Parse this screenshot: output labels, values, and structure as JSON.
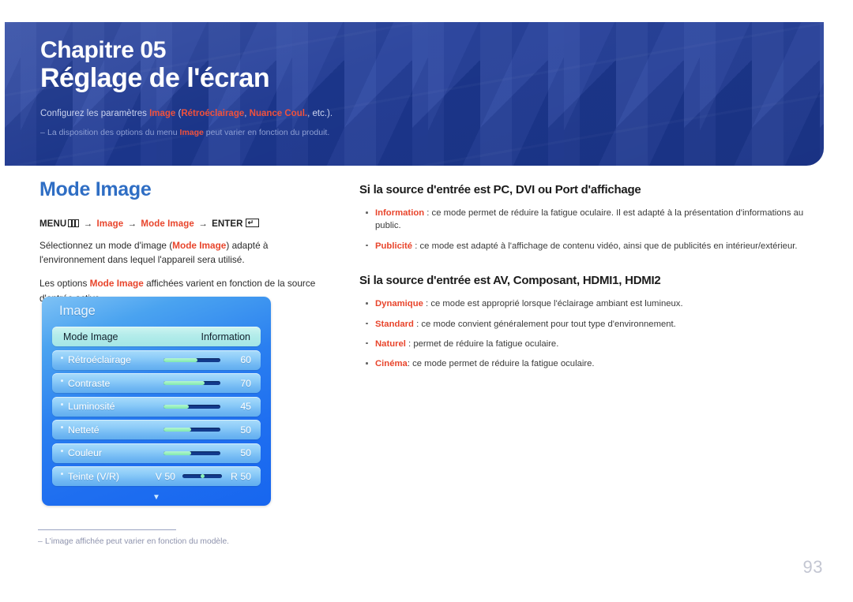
{
  "banner": {
    "chapter_label": "Chapitre 05",
    "chapter_title": "Réglage de l'écran",
    "description_pre": "Configurez les paramètres ",
    "description_hi1": "Image",
    "description_mid": " (",
    "description_hi2": "Rétroéclairage",
    "description_mid2": ", ",
    "description_hi3": "Nuance Coul.",
    "description_post": ", etc.).",
    "note_pre": "La disposition des options du menu ",
    "note_hi": "Image",
    "note_post": " peut varier en fonction du produit.",
    "bg_color": "#1f3b9b",
    "accent_color": "#f0513c"
  },
  "left": {
    "heading": "Mode Image",
    "menu_path": {
      "menu": "MENU",
      "menu_icon": "menu-bars-icon",
      "arrow": "→",
      "step1": "Image",
      "step2": "Mode Image",
      "enter": "ENTER",
      "enter_icon": "enter-key-icon"
    },
    "paragraph1_pre": "Sélectionnez un mode d'image (",
    "paragraph1_hi": "Mode Image",
    "paragraph1_post": ") adapté à l'environnement dans lequel l'appareil sera utilisé.",
    "paragraph2_pre": "Les options ",
    "paragraph2_hi": "Mode Image",
    "paragraph2_post": " affichées varient en fonction de la source d'entrée active."
  },
  "osd": {
    "title": "Image",
    "rows": [
      {
        "label": "Mode Image",
        "value_text": "Information",
        "type": "selected"
      },
      {
        "label": "Rétroéclairage",
        "value": 60,
        "fill_pct": 60,
        "type": "slider"
      },
      {
        "label": "Contraste",
        "value": 70,
        "fill_pct": 72,
        "type": "slider"
      },
      {
        "label": "Luminosité",
        "value": 45,
        "fill_pct": 45,
        "type": "slider"
      },
      {
        "label": "Netteté",
        "value": 50,
        "fill_pct": 48,
        "type": "slider"
      },
      {
        "label": "Couleur",
        "value": 50,
        "fill_pct": 48,
        "type": "slider"
      },
      {
        "label": "Teinte (V/R)",
        "left_text": "V 50",
        "right_text": "R 50",
        "type": "tint"
      }
    ],
    "scroll_caret": "▼"
  },
  "right": {
    "section1_title": "Si la source d'entrée est PC, DVI ou Port d'affichage",
    "section1_items": [
      {
        "term": "Information",
        "text": " : ce mode permet de réduire la fatigue oculaire. Il est adapté à la présentation d'informations au public."
      },
      {
        "term": "Publicité",
        "text": " : ce mode est adapté à l'affichage de contenu vidéo, ainsi que de publicités en intérieur/extérieur."
      }
    ],
    "section2_title": "Si la source d'entrée est AV, Composant, HDMI1, HDMI2",
    "section2_items": [
      {
        "term": "Dynamique",
        "text": " : ce mode est approprié lorsque l'éclairage ambiant est lumineux."
      },
      {
        "term": "Standard",
        "text": " : ce mode convient généralement pour tout type d'environnement."
      },
      {
        "term": "Naturel",
        "text": " : permet de réduire la fatigue oculaire."
      },
      {
        "term": "Cinéma",
        "text": ": ce mode permet de réduire la fatigue oculaire."
      }
    ]
  },
  "footer": {
    "note": "L'image affichée peut varier en fonction du modèle.",
    "page_number": "93"
  }
}
